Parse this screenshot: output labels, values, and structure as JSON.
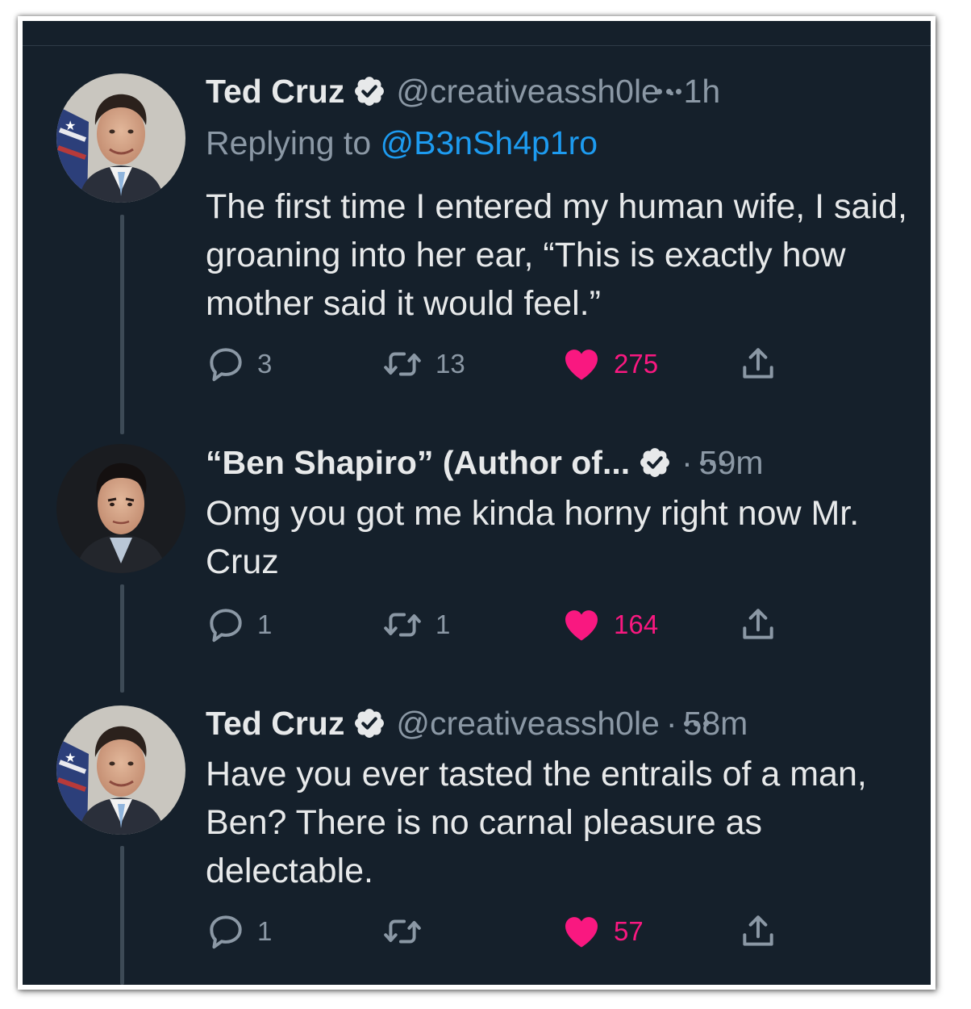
{
  "tweets": [
    {
      "author": "Ted Cruz",
      "handle": "@creativeassh0le",
      "separator": "·",
      "time": "1h",
      "replying_prefix": "Replying to ",
      "replying_to": "@B3nSh4p1ro",
      "text": "The first time I entered my human wife, I said, groaning into her ear, “This is exactly how mother said it would feel.”",
      "replies": "3",
      "retweets": "13",
      "likes": "275"
    },
    {
      "author": "“Ben Shapiro” (Author of...",
      "handle": "",
      "separator": "·",
      "time": "59m",
      "text": "Omg you got me kinda horny right now Mr. Cruz",
      "replies": "1",
      "retweets": "1",
      "likes": "164"
    },
    {
      "author": "Ted Cruz",
      "handle": "@creativeassh0le",
      "separator": "·",
      "time": "58m",
      "text": "Have you ever tasted the entrails of a man, Ben? There is no carnal pleasure as delectable.",
      "replies": "1",
      "retweets": "",
      "likes": "57"
    }
  ],
  "icons": {
    "verified": "verified-badge-icon",
    "reply": "reply-bubble-icon",
    "retweet": "retweet-icon",
    "like": "heart-icon",
    "share": "share-icon",
    "more": "more-dots-icon"
  },
  "colors": {
    "background": "#15202b",
    "text": "#e7e9ea",
    "muted": "#8b98a5",
    "link": "#1d9bf0",
    "like": "#f91880",
    "thread_line": "#3d4a56"
  }
}
